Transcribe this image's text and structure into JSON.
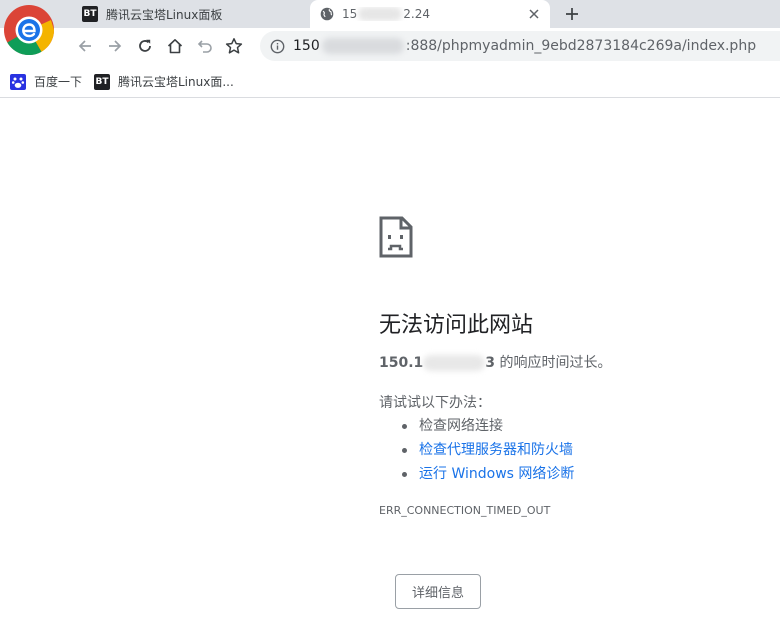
{
  "browser": {
    "tabs": [
      {
        "favicon_text": "BT",
        "title": "腾讯云宝塔Linux面板",
        "active": false
      },
      {
        "title_prefix": "15",
        "title_suffix": "2.24",
        "active": true
      }
    ],
    "address": {
      "prefix": "150",
      "suffix": ":888/phpmyadmin_9ebd2873184c269a/index.php"
    },
    "bookmarks": [
      {
        "icon": "baidu-paw-icon",
        "label": "百度一下"
      },
      {
        "icon": "bt-icon",
        "favicon_text": "BT",
        "label": "腾讯云宝塔Linux面..."
      }
    ]
  },
  "error_page": {
    "title": "无法访问此网站",
    "host_prefix": "150.1",
    "host_suffix": "3",
    "host_message": " 的响应时间过长。",
    "try_label": "请试试以下办法：",
    "suggestions": [
      {
        "text": "检查网络连接",
        "link": false
      },
      {
        "text": "检查代理服务器和防火墙",
        "link": true
      },
      {
        "text": "运行 Windows 网络诊断",
        "link": true
      }
    ],
    "error_code": "ERR_CONNECTION_TIMED_OUT",
    "details_button": "详细信息"
  },
  "colors": {
    "tabstrip": "#dee1e6",
    "omnibox": "#f1f3f4",
    "link": "#1a73e8",
    "secondary_text": "#5f6368"
  }
}
